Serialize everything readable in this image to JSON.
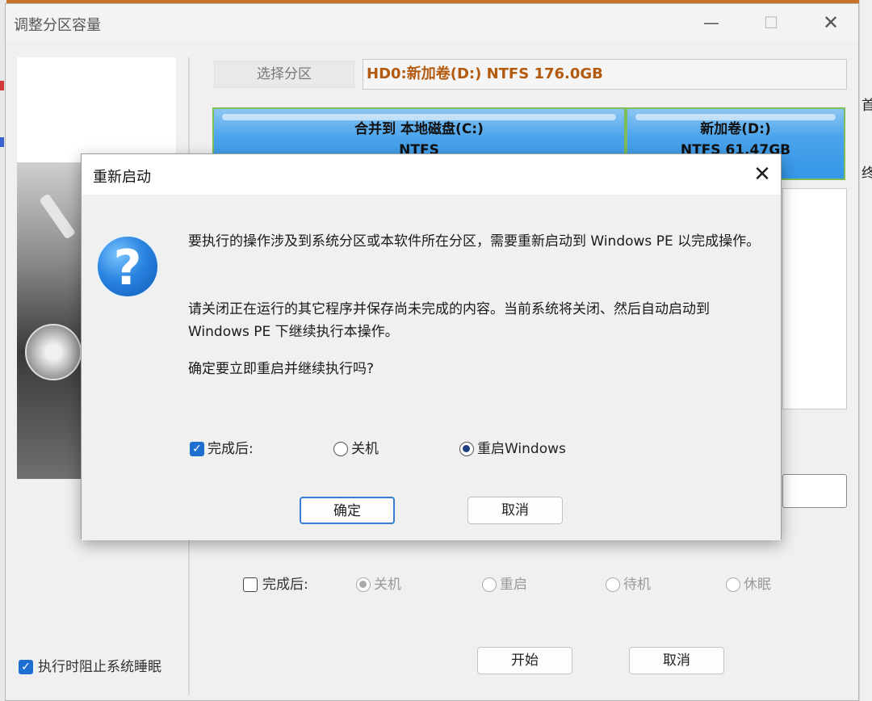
{
  "main_window": {
    "title": "调整分区容量",
    "controls": {
      "minimize": "—",
      "maximize": "☐",
      "close": "✕"
    },
    "select_partition_label": "选择分区",
    "selected_partition": "HD0:新加卷(D:) NTFS 176.0GB",
    "partitions": [
      {
        "line1": "合并到 本地磁盘(C:)",
        "line2": "NTFS"
      },
      {
        "line1": "新加卷(D:)",
        "line2": "NTFS 61.47GB"
      }
    ],
    "after_complete": {
      "label": "完成后:",
      "options": [
        "关机",
        "重启",
        "待机",
        "休眠"
      ]
    },
    "prevent_sleep_label": "执行时阻止系统睡眠",
    "start_button": "开始",
    "cancel_button": "取消"
  },
  "dialog": {
    "title": "重新启动",
    "close": "✕",
    "icon": "question-icon",
    "message_1": "要执行的操作涉及到系统分区或本软件所在分区，需要重新启动到 Windows PE 以完成操作。",
    "message_2": "请关闭正在运行的其它程序并保存尚未完成的内容。当前系统将关闭、然后自动启动到 Windows PE 下继续执行本操作。",
    "message_3": "确定要立即重启并继续执行吗?",
    "after_complete_label": "完成后:",
    "option_shutdown": "关机",
    "option_restart": "重启Windows",
    "ok_button": "确定",
    "cancel_button": "取消"
  },
  "side_text": {
    "top": "首",
    "middle": "终"
  }
}
